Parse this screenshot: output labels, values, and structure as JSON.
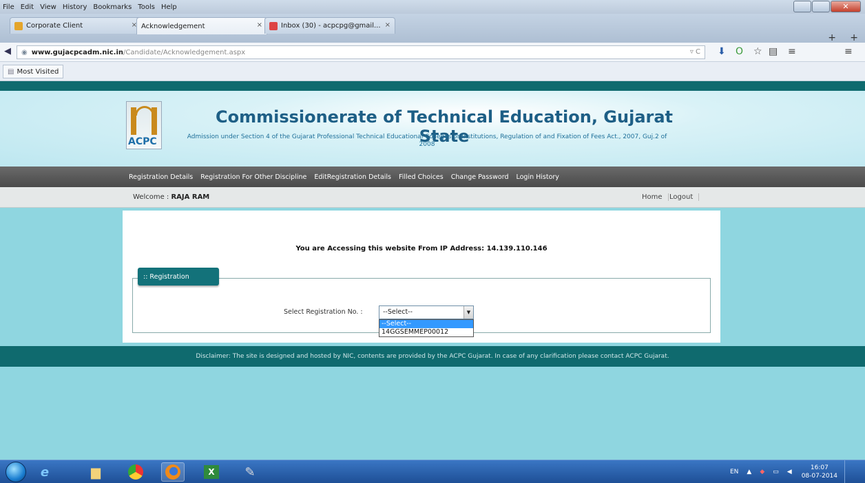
{
  "browser": {
    "menu": [
      "File",
      "Edit",
      "View",
      "History",
      "Bookmarks",
      "Tools",
      "Help"
    ],
    "tabs": [
      {
        "label": "Corporate Client",
        "close": "×"
      },
      {
        "label": "Acknowledgement",
        "close": "×"
      },
      {
        "label": "Inbox (30) - acpcpg@gmail...",
        "close": "×"
      }
    ],
    "new_tab": "+",
    "tab_list": "+",
    "url_host": "www.gujacpcadm.nic.in",
    "url_path": "/Candidate/Acknowledgement.aspx",
    "url_reload": "▿ C",
    "bookmark": "Most Visited"
  },
  "site": {
    "logo_text": "ACPC",
    "title": "Commissionerate of Technical Education, Gujarat State",
    "subtitle": "Admission under Section 4 of the Gujarat Professional Technical Educational Colleges or Institutions, Regulation of and Fixation of Fees Act., 2007, Guj.2 of 2008",
    "nav": [
      "Registration Details",
      "Registration For Other Discipline",
      "EditRegistration Details",
      "Filled Choices",
      "Change Password",
      "Login History"
    ],
    "welcome_label": "Welcome :",
    "welcome_name": "RAJA RAM",
    "home": "Home",
    "logout": "Logout",
    "ip_note": "You are Accessing this website From IP Address: 14.139.110.146",
    "legend": ":: Registration",
    "select_label": "Select Registration No. :",
    "select_value": "--Select--",
    "options": [
      "--Select--",
      "14GGSEMMEP00012"
    ],
    "footer": "Disclaimer: The site is designed and hosted by NIC, contents are provided by the ACPC Gujarat. In case of any clarification please contact ACPC Gujarat."
  },
  "taskbar": {
    "lang": "EN",
    "time": "16:07",
    "date": "08-07-2014"
  }
}
